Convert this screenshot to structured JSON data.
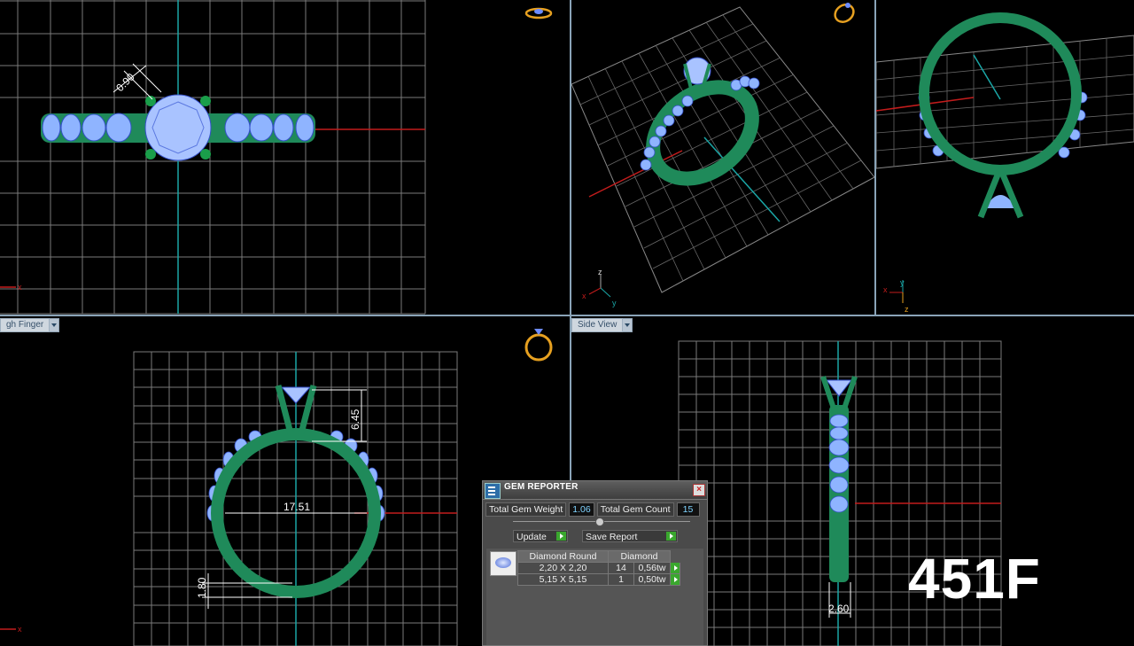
{
  "viewports": {
    "bottom_left_view": "gh Finger",
    "bottom_right_view": "Side View"
  },
  "dimensions": {
    "top_left": "0.90",
    "bottom_left_height": "6.45",
    "bottom_left_diameter": "17.51",
    "bottom_left_band": "1.80",
    "bottom_right_width": "2.60"
  },
  "axes": {
    "x": "x",
    "y": "y",
    "z": "z"
  },
  "gem_reporter": {
    "title": "GEM REPORTER",
    "total_weight_label": "Total Gem Weight",
    "total_weight_value": "1.06",
    "total_count_label": "Total Gem Count",
    "total_count_value": "15",
    "update_label": "Update",
    "save_label": "Save Report",
    "header_shape": "Diamond Round",
    "header_type": "Diamond",
    "rows": [
      {
        "size": "2,20 X 2,20",
        "count": "14",
        "weight": "0,56tw"
      },
      {
        "size": "5,15 X 5,15",
        "count": "1",
        "weight": "0,50tw"
      }
    ]
  },
  "model_label": "451F",
  "colors": {
    "metal": "#1f8a5a",
    "gem": "#8fb4ff",
    "grid": "#8a8a8a",
    "x_axis": "#c21c1c",
    "y_axis": "#1aa6a6",
    "divider": "#8aa4b8"
  },
  "icons": [
    "ring-icon-top",
    "ring-icon-perspective",
    "ring-icon-front"
  ]
}
